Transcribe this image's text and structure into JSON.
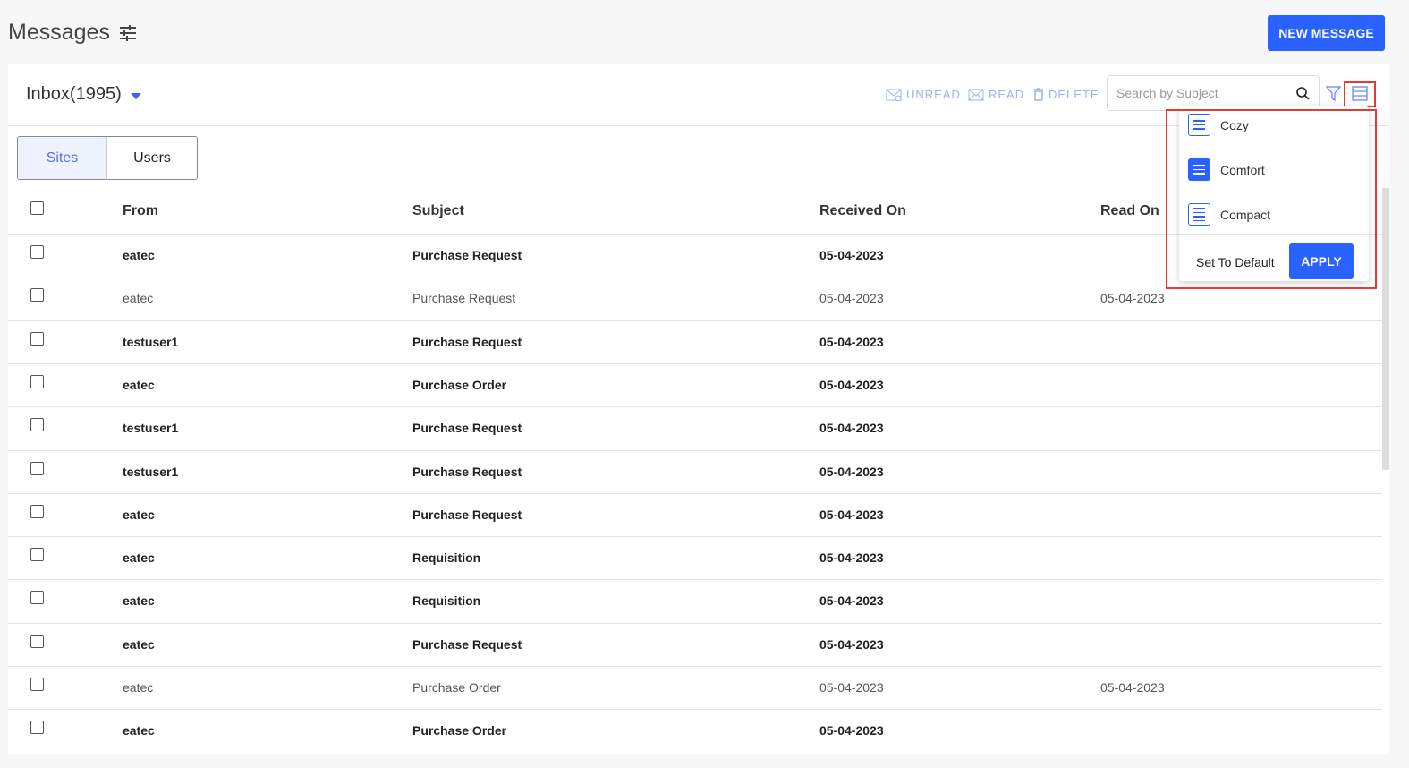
{
  "header": {
    "title": "Messages",
    "new_message": "NEW MESSAGE"
  },
  "inbox": {
    "label": "Inbox(1995)"
  },
  "actions": {
    "unread": "UNREAD",
    "read": "READ",
    "delete": "DELETE"
  },
  "search": {
    "placeholder": "Search by Subject"
  },
  "tabs": [
    {
      "label": "Sites",
      "active": true
    },
    {
      "label": "Users",
      "active": false
    }
  ],
  "columns": {
    "from": "From",
    "subject": "Subject",
    "received": "Received On",
    "read": "Read On"
  },
  "rows": [
    {
      "from": "eatec",
      "subject": "Purchase Request",
      "received": "05-04-2023",
      "read_on": "",
      "unread": true
    },
    {
      "from": "eatec",
      "subject": "Purchase Request",
      "received": "05-04-2023",
      "read_on": "05-04-2023",
      "unread": false
    },
    {
      "from": "testuser1",
      "subject": "Purchase Request",
      "received": "05-04-2023",
      "read_on": "",
      "unread": true
    },
    {
      "from": "eatec",
      "subject": "Purchase Order",
      "received": "05-04-2023",
      "read_on": "",
      "unread": true
    },
    {
      "from": "testuser1",
      "subject": "Purchase Request",
      "received": "05-04-2023",
      "read_on": "",
      "unread": true
    },
    {
      "from": "testuser1",
      "subject": "Purchase Request",
      "received": "05-04-2023",
      "read_on": "",
      "unread": true
    },
    {
      "from": "eatec",
      "subject": "Purchase Request",
      "received": "05-04-2023",
      "read_on": "",
      "unread": true
    },
    {
      "from": "eatec",
      "subject": "Requisition",
      "received": "05-04-2023",
      "read_on": "",
      "unread": true
    },
    {
      "from": "eatec",
      "subject": "Requisition",
      "received": "05-04-2023",
      "read_on": "",
      "unread": true
    },
    {
      "from": "eatec",
      "subject": "Purchase Request",
      "received": "05-04-2023",
      "read_on": "",
      "unread": true
    },
    {
      "from": "eatec",
      "subject": "Purchase Order",
      "received": "05-04-2023",
      "read_on": "05-04-2023",
      "unread": false
    },
    {
      "from": "eatec",
      "subject": "Purchase Order",
      "received": "05-04-2023",
      "read_on": "",
      "unread": true
    }
  ],
  "density_menu": {
    "options": [
      {
        "label": "Cozy",
        "selected": false
      },
      {
        "label": "Comfort",
        "selected": true
      },
      {
        "label": "Compact",
        "selected": false
      }
    ],
    "set_default": "Set To Default",
    "apply": "APPLY"
  },
  "colors": {
    "accent": "#2962ff",
    "highlight": "#e53935"
  }
}
